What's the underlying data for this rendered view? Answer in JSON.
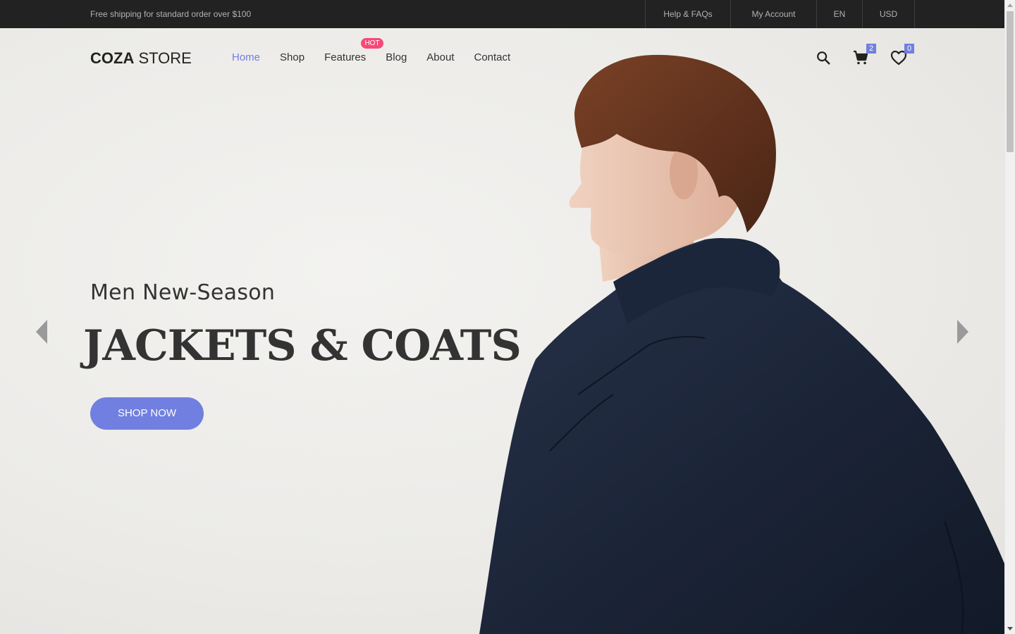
{
  "topbar": {
    "promo": "Free shipping for standard order over $100",
    "links": [
      "Help & FAQs",
      "My Account",
      "EN",
      "USD"
    ]
  },
  "header": {
    "logo_bold": "COZA",
    "logo_light": "STORE",
    "nav": [
      "Home",
      "Shop",
      "Features",
      "Blog",
      "About",
      "Contact"
    ],
    "active_nav": "Home",
    "hot_badge": "HOT",
    "cart_count": "2",
    "wishlist_count": "0",
    "icons": [
      "search-icon",
      "cart-icon",
      "heart-icon"
    ]
  },
  "hero": {
    "subtitle": "Men New-Season",
    "title": "JACKETS & COATS",
    "cta": "SHOP NOW",
    "prev_icon": "chevron-left-icon",
    "next_icon": "chevron-right-icon"
  },
  "colors": {
    "accent": "#717fe0",
    "hot": "#f74877",
    "topbar": "#222222"
  }
}
